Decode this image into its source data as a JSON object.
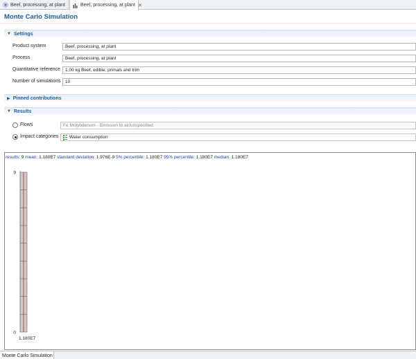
{
  "tabs": [
    {
      "label": "Beef, processing, at plant",
      "icon": "process-icon",
      "active": false
    },
    {
      "label": "Beef, processing, at plant",
      "icon": "chart-icon",
      "active": true
    }
  ],
  "page_title": "Monte Carlo Simulation",
  "sections": {
    "settings": "Settings",
    "pinned": "Pinned contributions",
    "results": "Results"
  },
  "settings": {
    "product_system_label": "Product system",
    "product_system_value": "Beef, processing, at plant",
    "process_label": "Process",
    "process_value": "Beef, processing, at plant",
    "quant_ref_label": "Quantitative reference",
    "quant_ref_value": "1.00 kg Beef, edible; primals and trim",
    "num_sim_label": "Number of simulations",
    "num_sim_value": "10"
  },
  "results": {
    "flows_label": "Flows",
    "flows_prefix": "Fe",
    "flows_value": "Molybdenum - Emission to air/unspecified",
    "impact_label": "Impact categories",
    "impact_value": "Water consumption",
    "selected": "impact"
  },
  "stats": {
    "results_k": "results:",
    "results_v": "9",
    "mean_k": "mean:",
    "mean_v": "1.180E7",
    "sd_k": "standard deviation:",
    "sd_v": "1.976E-9",
    "p5_k": "5% percentile:",
    "p5_v": "1.180E7",
    "p95_k": "95% percentile:",
    "p95_v": "1.180E7",
    "median_k": "median:",
    "median_v": "1.180E7"
  },
  "chart_data": {
    "type": "bar",
    "categories": [
      "1.180E7"
    ],
    "values": [
      9
    ],
    "ylim": [
      0,
      9
    ],
    "y_tick_labels": [
      "9",
      "0"
    ],
    "x_tick_labels": [
      "1.180E7"
    ],
    "grid": false,
    "bar_color": "#c9c9c9",
    "mean_line_color": "#e02020"
  },
  "bottom_tab": "Monte Carlo Simulation",
  "colors": {
    "accent": "#1d5f9e",
    "stat_key": "#1a3fb0"
  }
}
